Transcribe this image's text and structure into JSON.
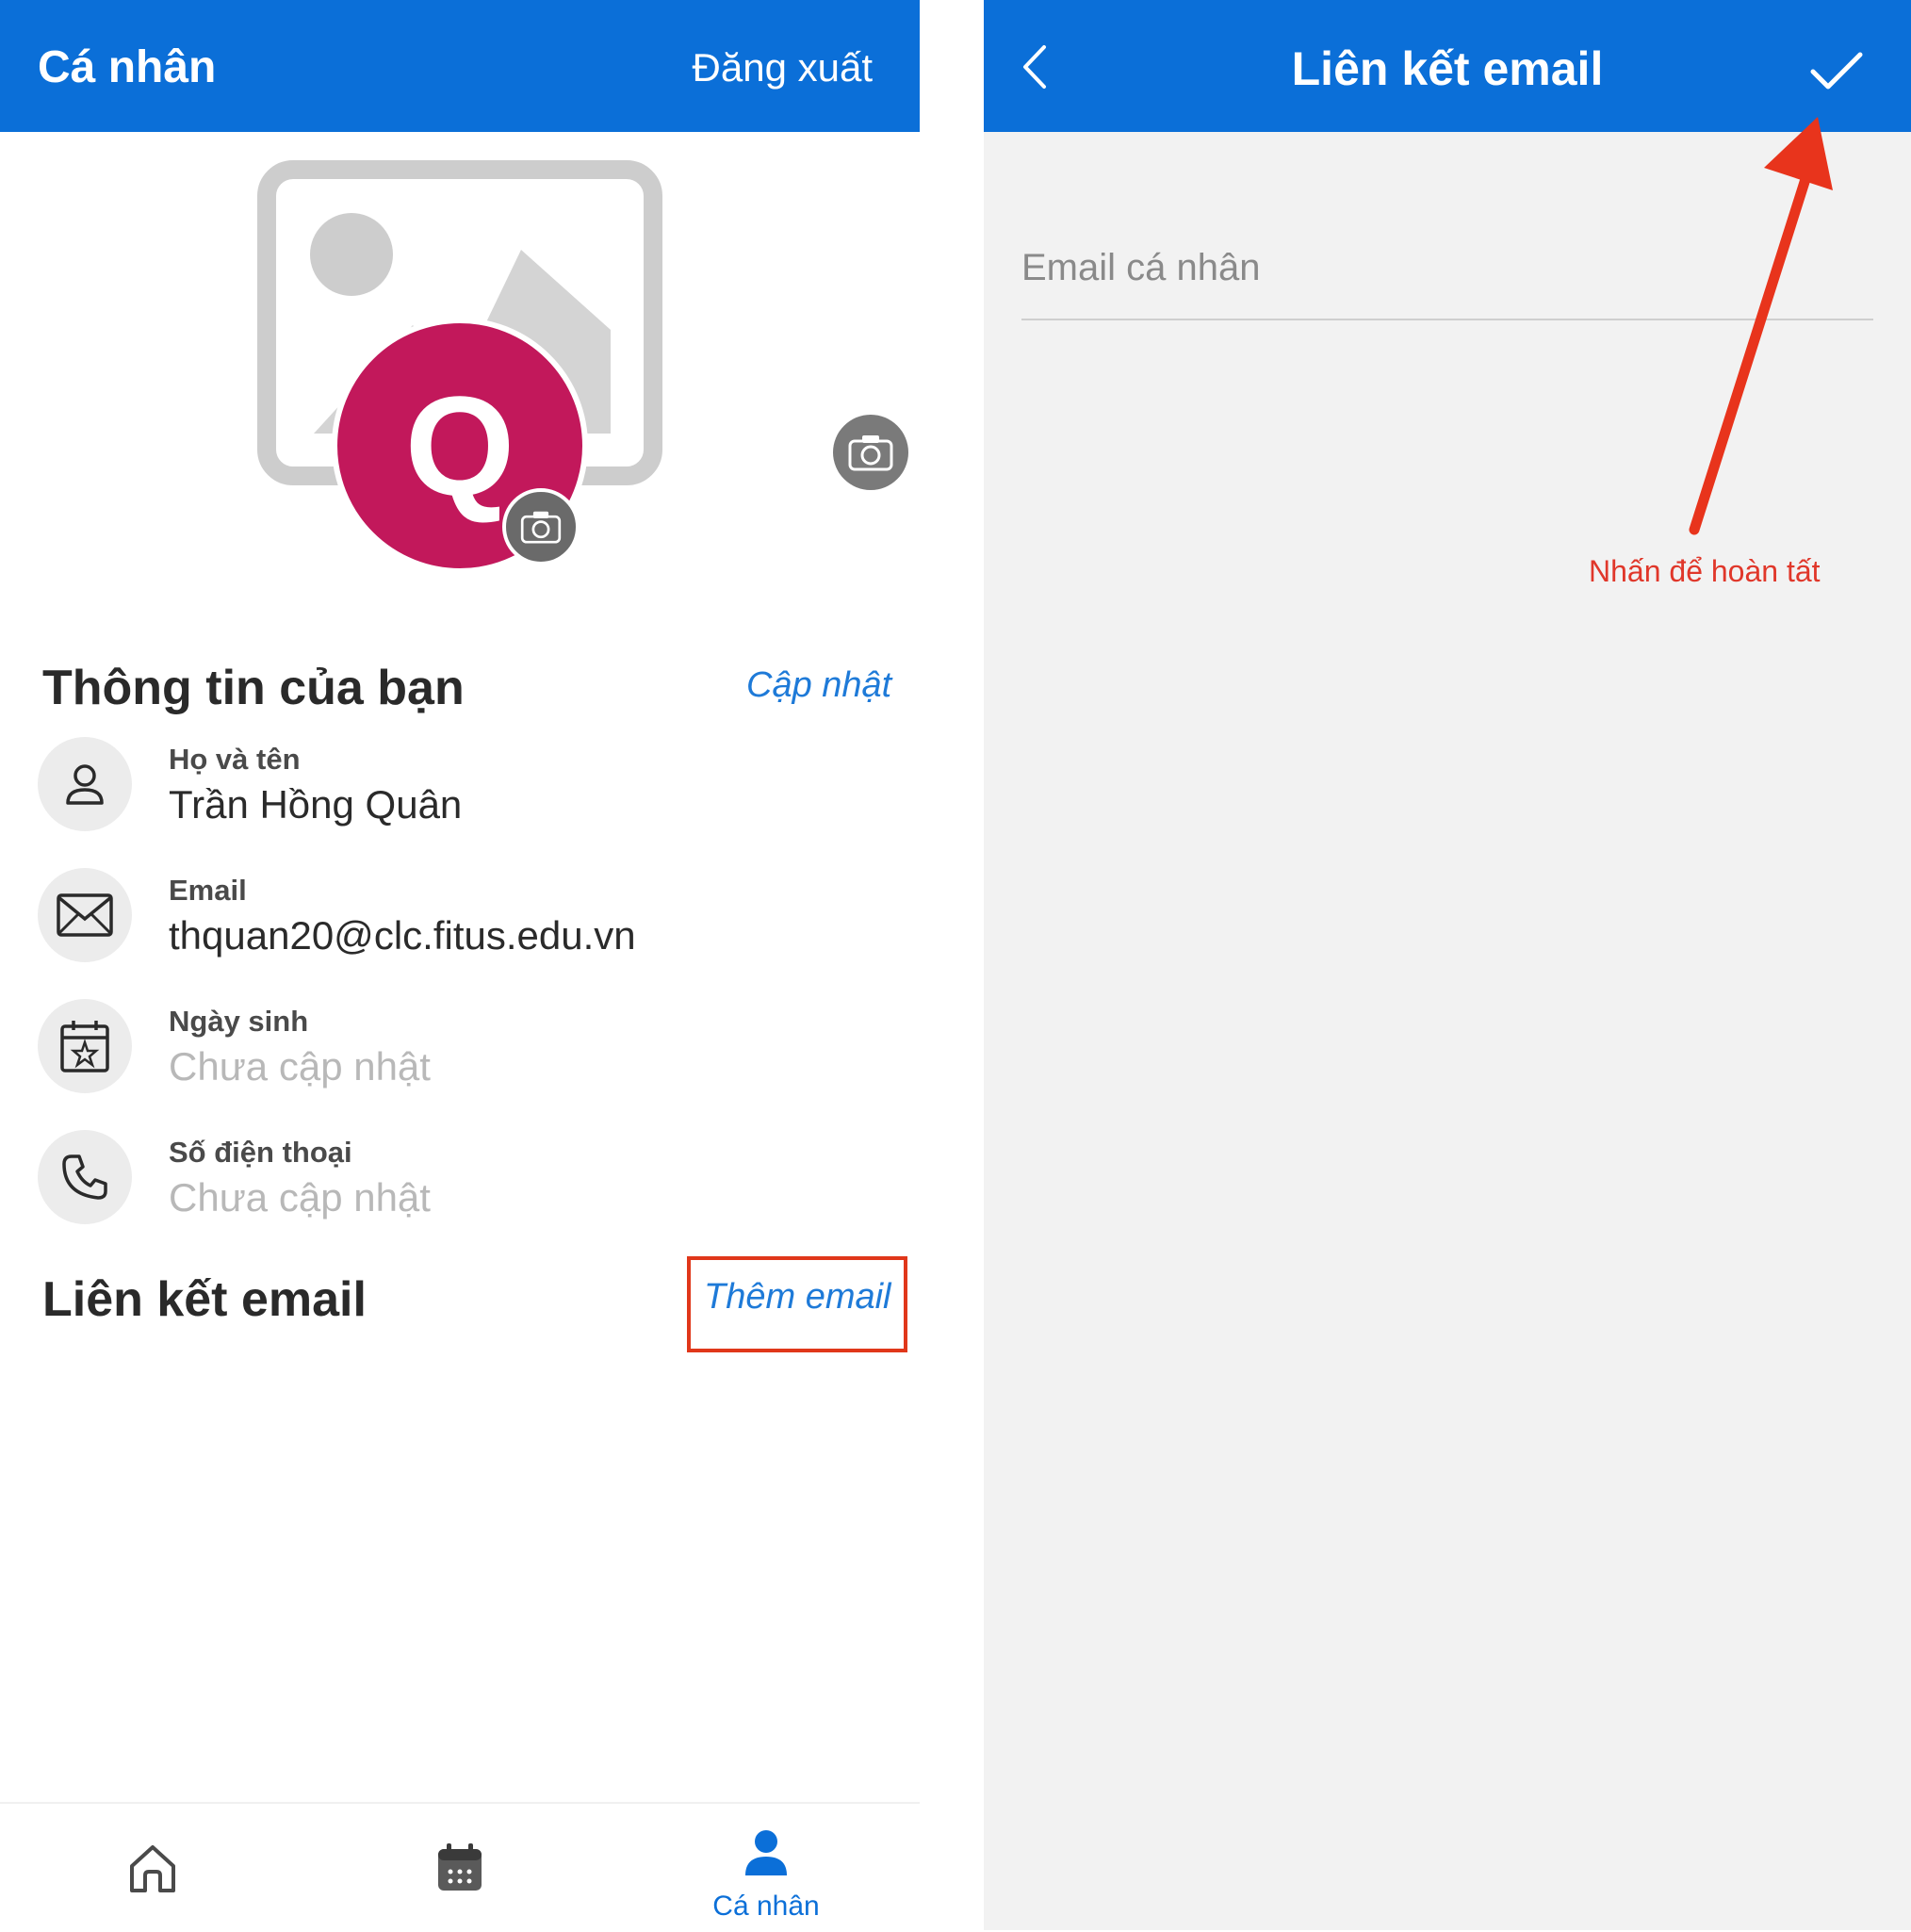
{
  "left_screen": {
    "header": {
      "title": "Cá nhân",
      "action_label": "Đăng xuất"
    },
    "profile": {
      "avatar_letter": "Q",
      "avatar_color": "#c2185b"
    },
    "info_section": {
      "title": "Thông tin của bạn",
      "action_label": "Cập nhật",
      "rows": [
        {
          "icon": "person-icon",
          "label": "Họ và tên",
          "value": "Trần Hồng Quân"
        },
        {
          "icon": "mail-icon",
          "label": "Email",
          "value": "thquan20@clc.fitus.edu.vn"
        },
        {
          "icon": "calendar-star-icon",
          "label": "Ngày sinh",
          "value": "Chưa cập nhật"
        },
        {
          "icon": "phone-icon",
          "label": "Số điện thoại",
          "value": "Chưa cập nhật"
        }
      ]
    },
    "email_link_section": {
      "title": "Liên kết email",
      "action_label": "Thêm email"
    },
    "bottom_nav": {
      "items": [
        {
          "icon": "home-icon",
          "label": ""
        },
        {
          "icon": "calendar-icon",
          "label": ""
        },
        {
          "icon": "person-icon",
          "label": "Cá nhân",
          "active": true
        }
      ]
    }
  },
  "right_screen": {
    "header": {
      "title": "Liên kết email",
      "back_icon": "chevron-left-icon",
      "confirm_icon": "check-icon"
    },
    "email_field": {
      "placeholder": "Email cá nhân",
      "value": ""
    },
    "annotation": {
      "text": "Nhấn để hoàn tất",
      "color": "#e0372a"
    }
  },
  "colors": {
    "primary": "#0b6fd8",
    "link": "#1e7ad8",
    "annotation_red": "#e0371a"
  }
}
